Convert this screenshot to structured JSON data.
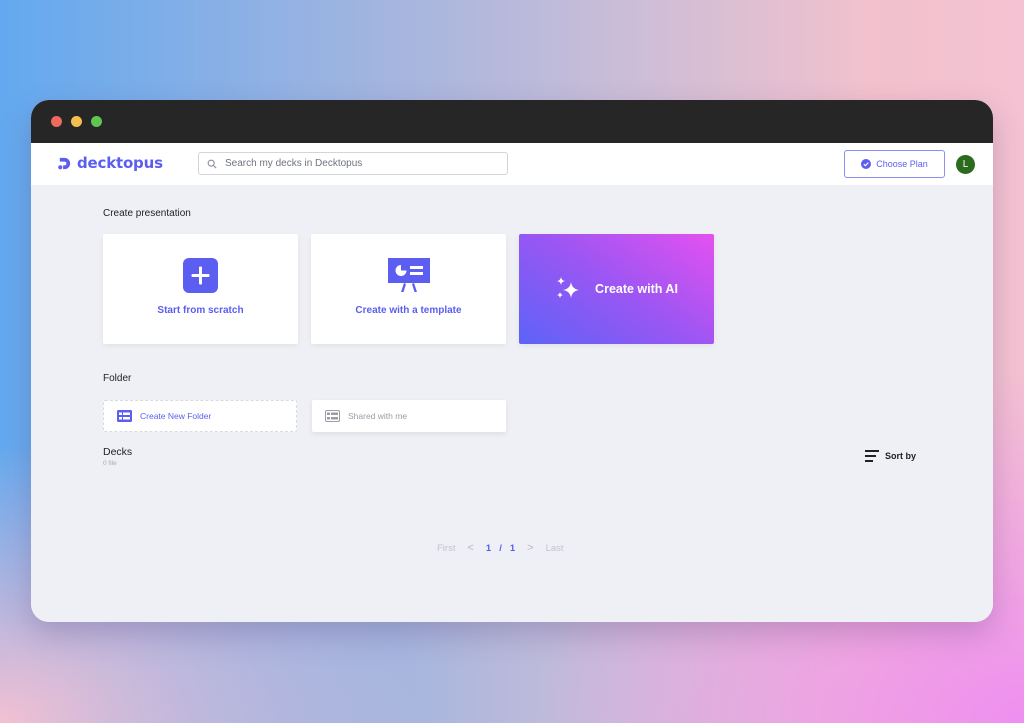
{
  "window": {
    "controls": [
      "close",
      "minimize",
      "maximize"
    ]
  },
  "header": {
    "logo_text": "decktopus",
    "search_placeholder": "Search my decks in Decktopus",
    "choose_plan_label": "Choose Plan",
    "avatar_initial": "L"
  },
  "create": {
    "section_title": "Create presentation",
    "cards": [
      {
        "label": "Start from scratch",
        "icon": "plus-icon"
      },
      {
        "label": "Create with a template",
        "icon": "presentation-board-icon"
      },
      {
        "label": "Create with AI",
        "icon": "sparkles-icon"
      }
    ]
  },
  "folder": {
    "section_title": "Folder",
    "create_new_label": "Create New Folder",
    "shared_label": "Shared with me"
  },
  "decks": {
    "title": "Decks",
    "count_text": "0 file",
    "sort_label": "Sort by"
  },
  "pagination": {
    "first": "First",
    "prev": "<",
    "current": "1",
    "separator": "/",
    "total": "1",
    "next": ">",
    "last": "Last"
  },
  "colors": {
    "brand": "#5b5ef0",
    "avatar_bg": "#2b6b1e",
    "ai_gradient_start": "#5d63f7",
    "ai_gradient_end": "#e451f0"
  }
}
